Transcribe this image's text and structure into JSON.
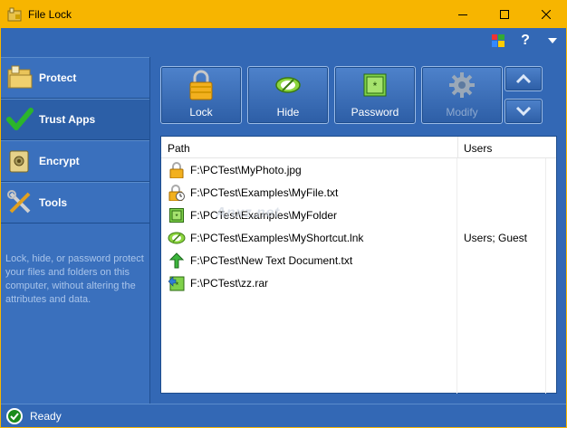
{
  "window": {
    "title": "File Lock",
    "minimize_icon": "minimize-icon",
    "maximize_icon": "maximize-icon",
    "close_icon": "close-icon"
  },
  "top_icons": [
    "theme-icon",
    "help-icon",
    "menu-dropdown-icon"
  ],
  "help_glyph": "?",
  "sidebar": {
    "items": [
      {
        "label": "Protect",
        "icon": "folder-icon",
        "active": false
      },
      {
        "label": "Trust Apps",
        "icon": "checkmark-icon",
        "active": true
      },
      {
        "label": "Encrypt",
        "icon": "safe-icon",
        "active": false
      },
      {
        "label": "Tools",
        "icon": "tools-icon",
        "active": false
      }
    ],
    "description": "Lock, hide, or password protect your files and folders on this computer, without altering the attributes and data."
  },
  "toolbar": {
    "buttons": [
      {
        "label": "Lock",
        "icon": "padlock-icon",
        "enabled": true
      },
      {
        "label": "Hide",
        "icon": "eye-hide-icon",
        "enabled": true
      },
      {
        "label": "Password",
        "icon": "password-icon",
        "enabled": true
      },
      {
        "label": "Modify",
        "icon": "gear-icon",
        "enabled": false
      }
    ],
    "move_up_icon": "chevron-up-icon",
    "move_down_icon": "chevron-down-icon"
  },
  "list": {
    "columns": [
      "Path",
      "Users"
    ],
    "rows": [
      {
        "path": "F:\\PCTest\\MyPhoto.jpg",
        "users": "",
        "icon": "lock-file-icon"
      },
      {
        "path": "F:\\PCTest\\Examples\\MyFile.txt",
        "users": "",
        "icon": "lock-clock-icon"
      },
      {
        "path": "F:\\PCTest\\Examples\\MyFolder",
        "users": "",
        "icon": "password-file-icon"
      },
      {
        "path": "F:\\PCTest\\Examples\\MyShortcut.lnk",
        "users": "Users; Guest",
        "icon": "hidden-file-icon"
      },
      {
        "path": "F:\\PCTest\\New Text Document.txt",
        "users": "",
        "icon": "green-arrow-icon"
      },
      {
        "path": "F:\\PCTest\\zz.rar",
        "users": "",
        "icon": "password-shortcut-icon"
      }
    ]
  },
  "watermark": "Anxz.net",
  "status": {
    "text": "Ready",
    "icon": "ready-check-icon"
  },
  "colors": {
    "titlebar": "#f7b500",
    "accent_blue": "#3368b5",
    "status_green": "#1a8a1a"
  }
}
